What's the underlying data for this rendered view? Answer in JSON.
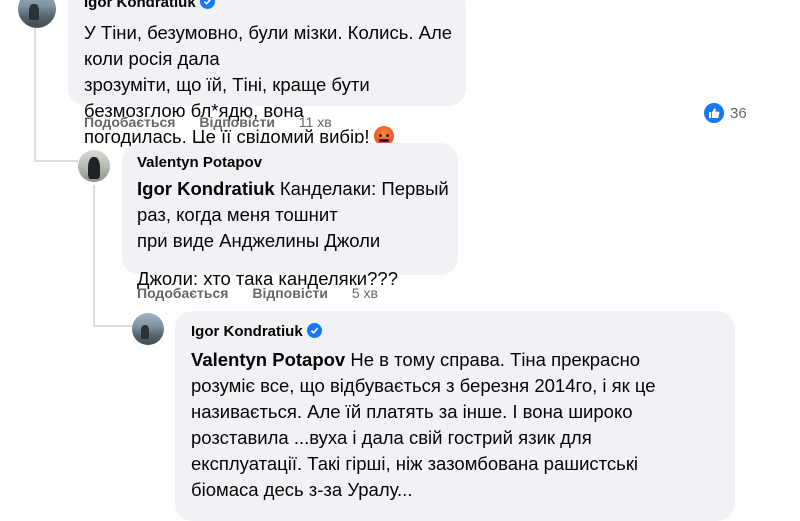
{
  "comments": [
    {
      "author": "Igor Kondratiuk",
      "verified": true,
      "lines": [
        "У Тіни, безумовно, були мізки. Колись. Але коли росія дала",
        "зрозуміти, що їй, Тіні, краще бути безмозглою бл*ядю, вона",
        "погодилась. Це її свідомий вибір!"
      ],
      "emoji": "angry-face-icon",
      "actions": {
        "like": "Подобається",
        "reply": "Відповісти",
        "time": "11 хв"
      },
      "reaction_count": "36"
    },
    {
      "author": "Valentyn Potapov",
      "mention": "Igor Kondratiuk",
      "line1_rest": " Канделаки: Первый раз, когда меня тошнит",
      "line2": "при виде Анджелины Джоли",
      "line3": "Джоли: хто така канделяки???",
      "actions": {
        "like": "Подобається",
        "reply": "Відповісти",
        "time": "5 хв"
      }
    },
    {
      "author": "Igor Kondratiuk",
      "verified": true,
      "mention": "Valentyn Potapov",
      "line1_rest": " Не в тому справа. Тіна прекрасно",
      "lines": [
        "розуміє все, що відбувається з березня 2014го, і як це",
        "називається. Але їй платять за інше. І вона широко",
        "розставила ...вуха і дала свій гострий язик для",
        "експлуатації. Такі гірші, ніж зазомбована рашистські",
        "біомаса десь з-за Уралу..."
      ]
    }
  ],
  "colors": {
    "bubble": "#f0f2f5",
    "meta": "#65676b",
    "accent": "#1877f2"
  }
}
